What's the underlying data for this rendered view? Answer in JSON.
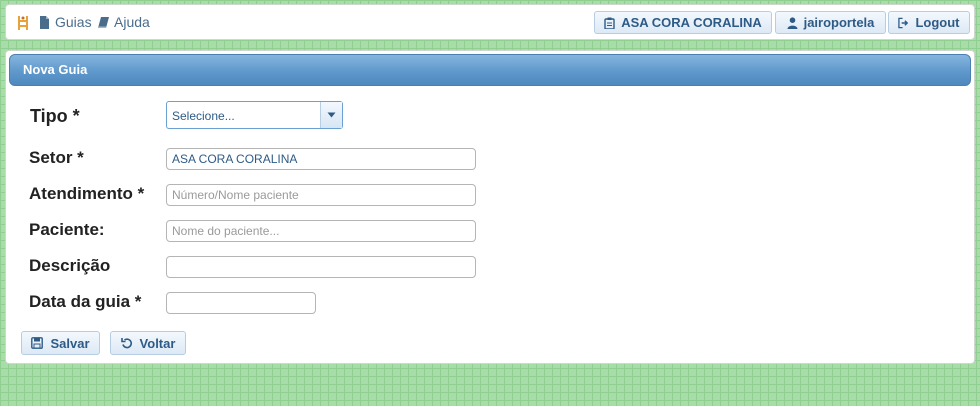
{
  "topbar": {
    "nav": [
      {
        "label": "Guias",
        "icon": "document-icon"
      },
      {
        "label": "Ajuda",
        "icon": "book-icon"
      }
    ],
    "org_button": "ASA CORA CORALINA",
    "user_button": "jairoportela",
    "logout_button": "Logout"
  },
  "panel": {
    "title": "Nova Guia"
  },
  "form": {
    "tipo": {
      "label": "Tipo  *",
      "value": "Selecione..."
    },
    "setor": {
      "label": "Setor  *",
      "value": "ASA CORA CORALINA"
    },
    "atendimento": {
      "label": "Atendimento  *",
      "placeholder": "Número/Nome paciente",
      "value": ""
    },
    "paciente": {
      "label": "Paciente:",
      "placeholder": "Nome do paciente...",
      "value": ""
    },
    "descricao": {
      "label": "Descrição",
      "value": ""
    },
    "data": {
      "label": "Data da guia  *",
      "value": ""
    }
  },
  "actions": {
    "save": "Salvar",
    "back": "Voltar"
  },
  "colors": {
    "accent": "#2e5b86",
    "header": "#5f98cc",
    "background": "#a8dca8"
  }
}
